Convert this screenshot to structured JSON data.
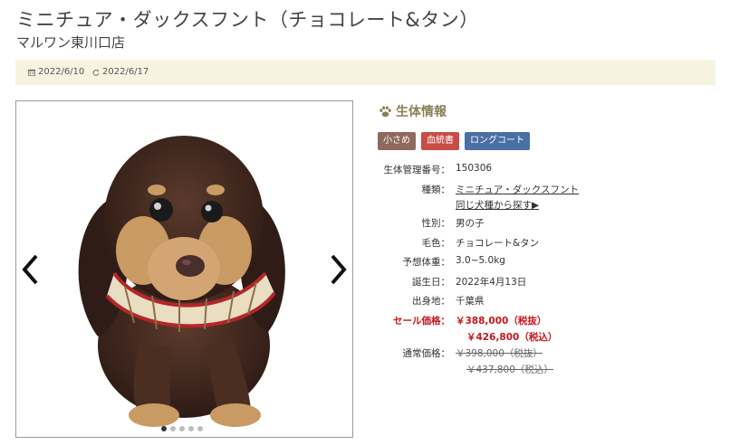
{
  "header": {
    "title": "ミニチュア・ダックスフント（チョコレート&タン）",
    "shop": "マルワン東川口店"
  },
  "dates": {
    "created": "2022/6/10",
    "updated": "2022/6/17"
  },
  "info": {
    "heading": "生体情報",
    "badges": [
      {
        "label": "小さめ",
        "color": "#8e6a5c"
      },
      {
        "label": "血統書",
        "color": "#c94d47"
      },
      {
        "label": "ロングコート",
        "color": "#4a6fa5"
      }
    ],
    "rows": {
      "id": {
        "label": "生体管理番号：",
        "value": "150306"
      },
      "breed": {
        "label": "種類：",
        "value": "ミニチュア・ダックスフント",
        "link2": "同じ犬種から探す▶"
      },
      "sex": {
        "label": "性別：",
        "value": "男の子"
      },
      "color": {
        "label": "毛色：",
        "value": "チョコレート&タン"
      },
      "weight": {
        "label": "予想体重：",
        "value": "3.0~5.0kg"
      },
      "birthday": {
        "label": "誕生日：",
        "value": "2022年4月13日"
      },
      "origin": {
        "label": "出身地：",
        "value": "千葉県"
      },
      "sale": {
        "label": "セール価格：",
        "value": "￥388,000（税抜）",
        "value2": "￥426,800（税込）"
      },
      "regular": {
        "label": "通常価格：",
        "value": "￥398,000（税抜）",
        "value2": "￥437,800（税込）"
      }
    }
  },
  "gallery": {
    "slide_count": 5,
    "active_index": 0
  }
}
